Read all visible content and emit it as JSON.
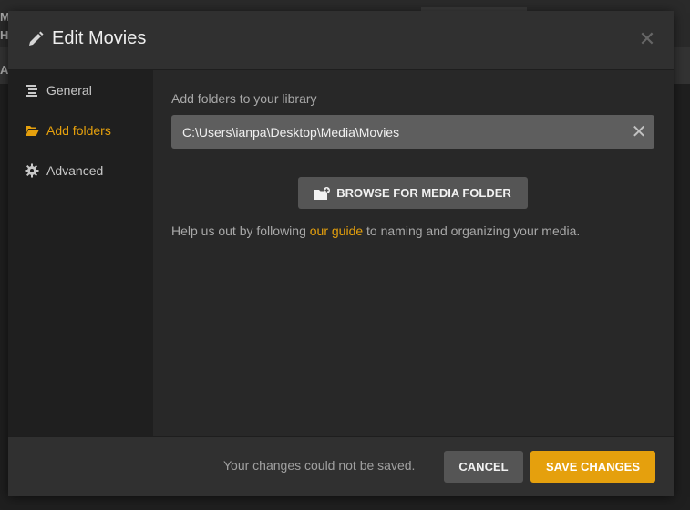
{
  "background": {
    "letters": [
      "M",
      "H",
      "A"
    ]
  },
  "dialog": {
    "title": "Edit Movies",
    "close_icon": "close-icon"
  },
  "sidebar": {
    "items": [
      {
        "label": "General",
        "icon": "list-icon",
        "active": false
      },
      {
        "label": "Add folders",
        "icon": "folder-open-icon",
        "active": true
      },
      {
        "label": "Advanced",
        "icon": "gear-icon",
        "active": false
      }
    ]
  },
  "content": {
    "field_label": "Add folders to your library",
    "path_value": "C:\\Users\\ianpa\\Desktop\\Media\\Movies",
    "browse_label": "BROWSE FOR MEDIA FOLDER",
    "help_before": "Help us out by following ",
    "help_link": "our guide",
    "help_after": " to naming and organizing your media."
  },
  "footer": {
    "error_text": "Your changes could not be saved.",
    "cancel_label": "CANCEL",
    "save_label": "SAVE CHANGES"
  },
  "colors": {
    "accent": "#e5a00d",
    "button_gray": "#555555",
    "input_bg": "#5e5e5e"
  }
}
